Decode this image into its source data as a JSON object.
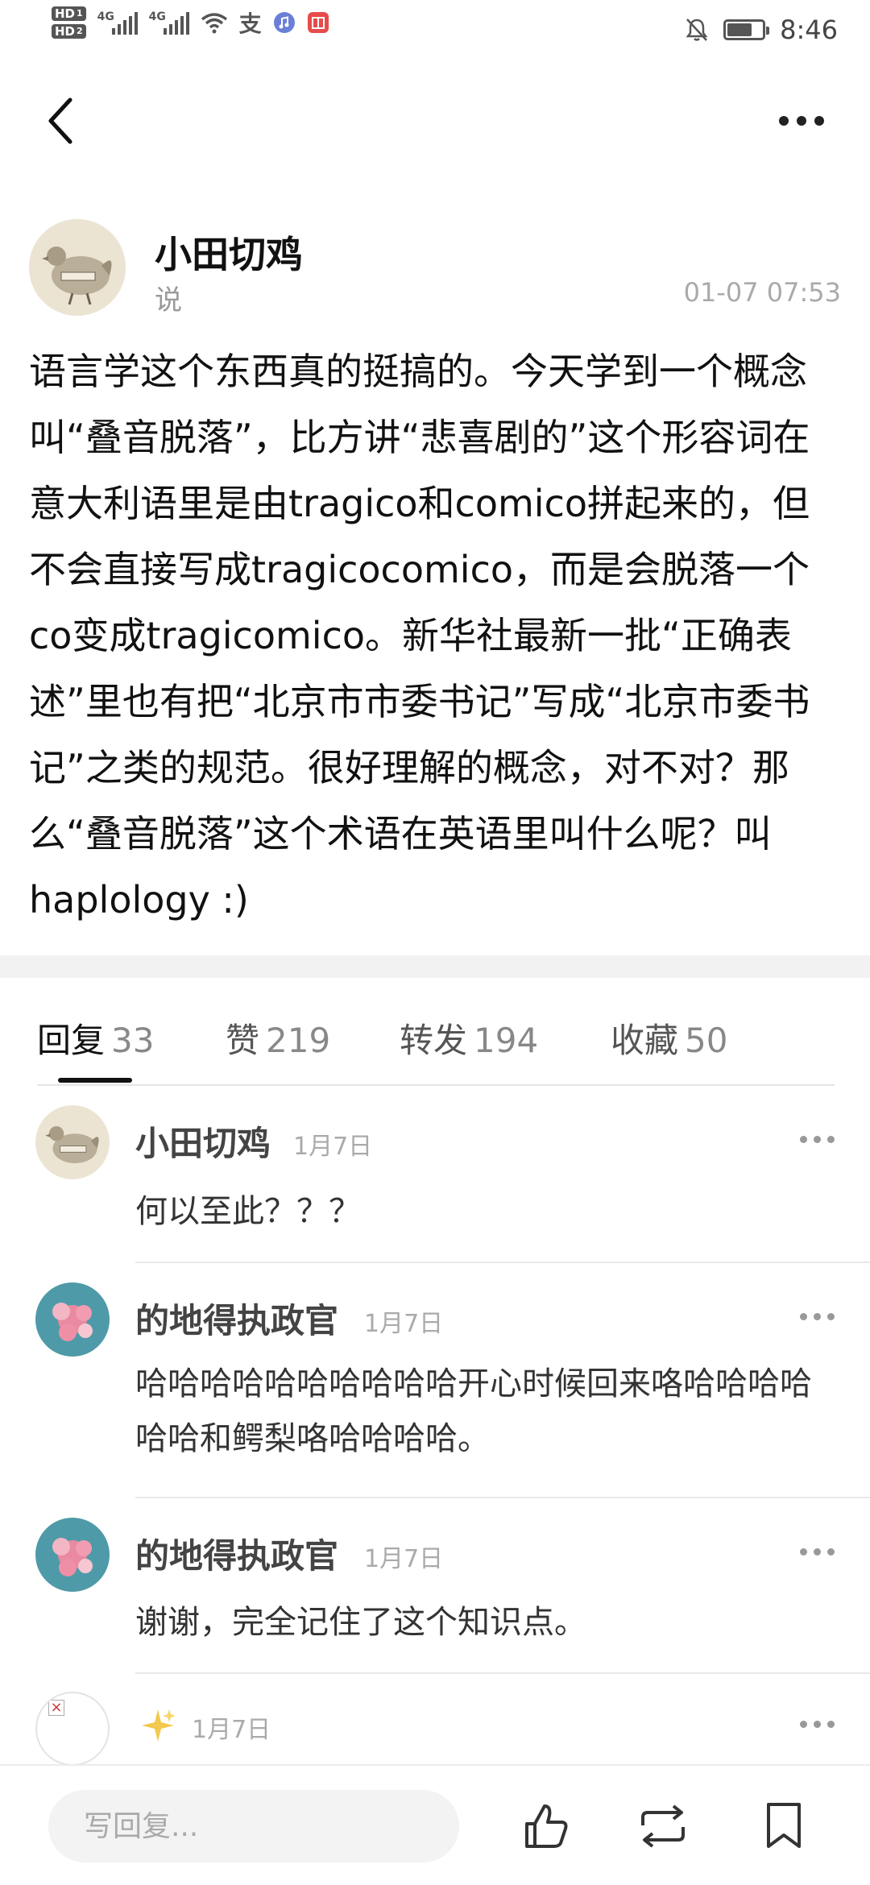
{
  "status_bar": {
    "hd1": "HD",
    "hd1_sub": "1",
    "hd2": "HD",
    "hd2_sub": "2",
    "sig1_label": "4G",
    "sig2_label": "4G",
    "alipay_glyph": "支",
    "time": "8:46",
    "battery_level": 0.7,
    "icons": [
      "signal-icon",
      "wifi-icon",
      "alipay-icon",
      "music-icon",
      "book-app-icon",
      "mute-bell-icon",
      "battery-icon"
    ]
  },
  "nav": {
    "back_icon": "back-chevron-icon",
    "more_icon": "more-dots-icon"
  },
  "post": {
    "author": "小田切鸡",
    "action": "说",
    "time": "01-07 07:53",
    "body": "语言学这个东西真的挺搞的。今天学到一个概念叫“叠音脱落”，比方讲“悲喜剧的”这个形容词在意大利语里是由tragico和comico拼起来的，但不会直接写成tragicocomico，而是会脱落一个co变成tragicomico。新华社最新一批“正确表述”里也有把“北京市市委书记”写成“北京市委书记”之类的规范。很好理解的概念，对不对？那么“叠音脱落”这个术语在英语里叫什么呢？叫haplology :)"
  },
  "tabs": [
    {
      "label": "回复",
      "count": "33"
    },
    {
      "label": "赞",
      "count": "219"
    },
    {
      "label": "转发",
      "count": "194"
    },
    {
      "label": "收藏",
      "count": "50"
    }
  ],
  "comments": [
    {
      "author": "小田切鸡",
      "date": "1月7日",
      "text": "何以至此？？？"
    },
    {
      "author": "的地得执政官",
      "date": "1月7日",
      "text": "哈哈哈哈哈哈哈哈哈哈开心时候回来咯哈哈哈哈哈哈和鳄梨咯哈哈哈哈。"
    },
    {
      "author": "的地得执政官",
      "date": "1月7日",
      "text": "谢谢，完全记住了这个知识点。"
    },
    {
      "author": "",
      "date": "1月7日",
      "text": "",
      "broken_avatar": "×"
    }
  ],
  "bottom_bar": {
    "reply_placeholder": "写回复...",
    "icons": [
      "like-icon",
      "repost-icon",
      "bookmark-icon"
    ]
  }
}
